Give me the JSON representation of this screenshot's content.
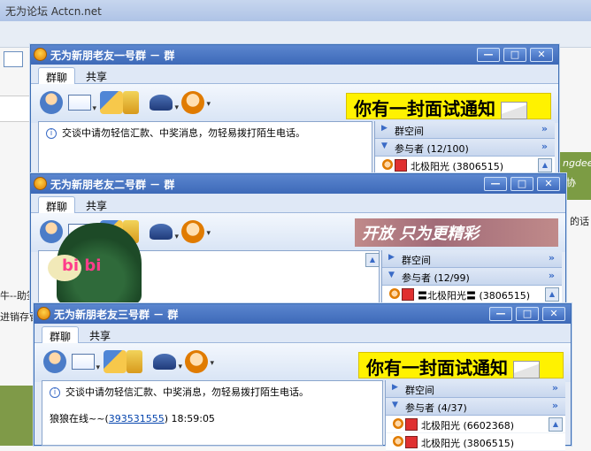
{
  "background": {
    "title": "无为论坛 Actcn.net",
    "left_fragments": [
      "牛--助签",
      "进销存管"
    ],
    "right_fragments": [
      "ngdee",
      "协",
      "的话"
    ]
  },
  "windows": [
    {
      "title": "无为新朋老友一号群 － 群",
      "tabs": [
        "群聊",
        "共享"
      ],
      "banner": "你有一封面试通知",
      "notice": "交谈中请勿轻信汇款、中奖消息，勿轻易拨打陌生电话。",
      "side": {
        "group_space": "群空间",
        "members_header": "参与者 (12/100)",
        "members": [
          {
            "name": "北极阳光",
            "id": "(3806515)"
          }
        ]
      }
    },
    {
      "title": "无为新朋老友二号群 － 群",
      "tabs": [
        "群聊",
        "共享"
      ],
      "banner": "开放 只为更精彩",
      "bibi": "bi bi",
      "side": {
        "group_space": "群空间",
        "members_header": "参与者 (12/99)",
        "members": [
          {
            "name": "〓北极阳光〓",
            "id": "(3806515)"
          }
        ]
      }
    },
    {
      "title": "无为新朋老友三号群 － 群",
      "tabs": [
        "群聊",
        "共享"
      ],
      "banner": "你有一封面试通知",
      "notice": "交谈中请勿轻信汇款、中奖消息，勿轻易拨打陌生电话。",
      "message": {
        "sender": "狼狼在线~~",
        "qq": "393531555",
        "time": "18:59:05"
      },
      "side": {
        "group_space": "群空间",
        "members_header": "参与者 (4/37)",
        "members": [
          {
            "name": "北极阳光",
            "id": "(6602368)"
          },
          {
            "name": "北极阳光",
            "id": "(3806515)"
          }
        ]
      }
    }
  ],
  "window_buttons": {
    "minimize": "—",
    "maximize": "□",
    "close": "✕"
  },
  "colors": {
    "title_blue": "#3d69b8",
    "banner_yellow": "#fff200"
  }
}
